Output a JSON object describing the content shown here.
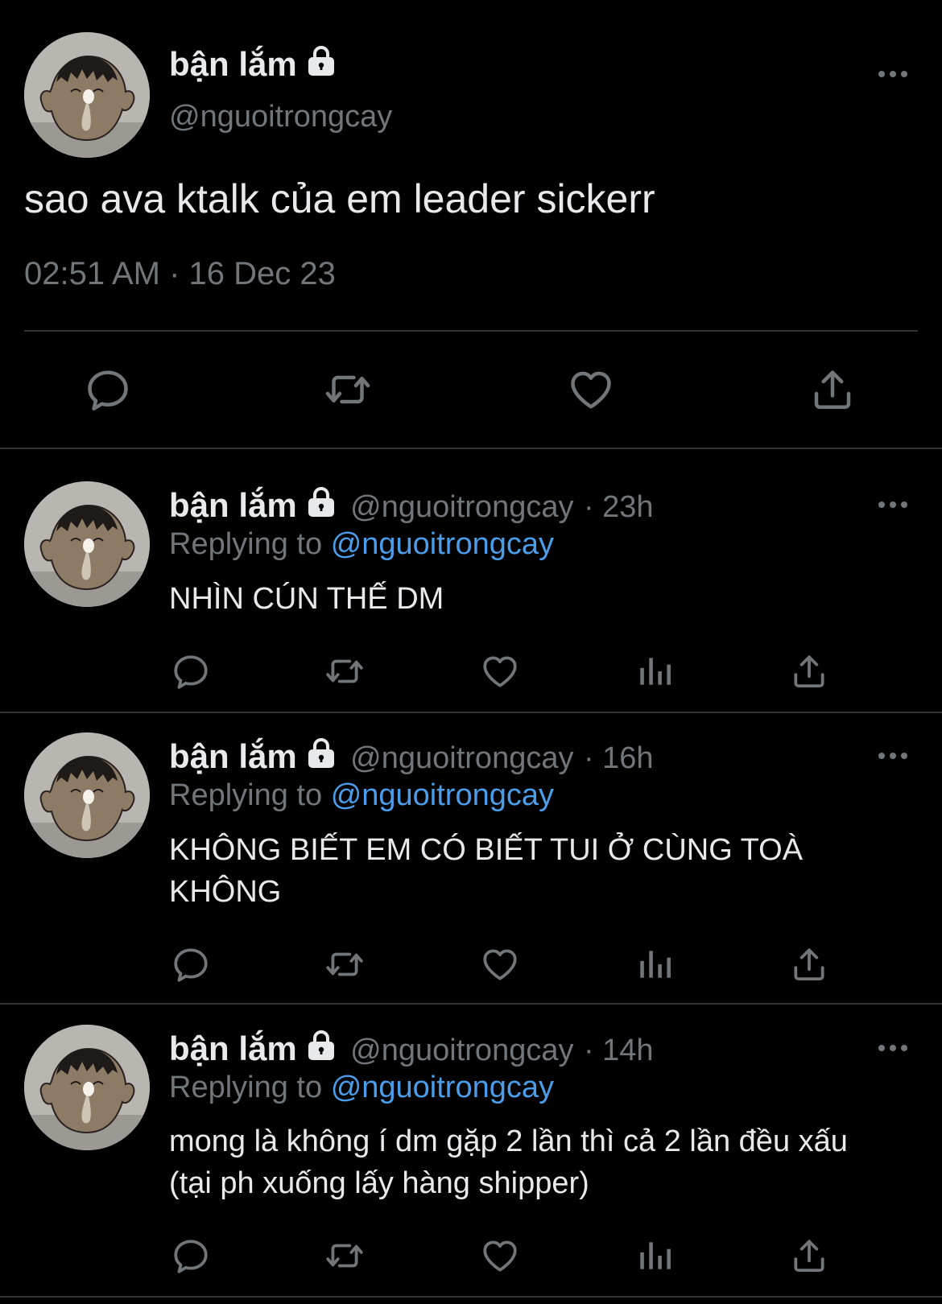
{
  "main_tweet": {
    "display_name": "bận lắm",
    "handle": "@nguoitrongcay",
    "text": "sao ava ktalk của em leader sickerr",
    "timestamp": "02:51 AM · 16 Dec 23"
  },
  "replies": [
    {
      "display_name": "bận lắm",
      "handle": "@nguoitrongcay",
      "time": "· 23h",
      "replying_label": "Replying to",
      "replying_handle": "@nguoitrongcay",
      "text": "NHÌN CÚN THẾ DM"
    },
    {
      "display_name": "bận lắm",
      "handle": "@nguoitrongcay",
      "time": "· 16h",
      "replying_label": "Replying to",
      "replying_handle": "@nguoitrongcay",
      "text": "KHÔNG BIẾT EM CÓ BIẾT TUI Ở CÙNG TOÀ KHÔNG"
    },
    {
      "display_name": "bận lắm",
      "handle": "@nguoitrongcay",
      "time": "· 14h",
      "replying_label": "Replying to",
      "replying_handle": "@nguoitrongcay",
      "text": "mong là không í dm gặp 2 lần thì cả 2 lần đều xấu (tại ph xuống lấy hàng shipper)"
    }
  ],
  "colors": {
    "background": "#000000",
    "text_primary": "#e7e9ea",
    "text_muted": "#71767b",
    "link": "#4b9ce9",
    "divider": "#2f3336"
  },
  "icons": [
    "avatar",
    "lock-icon",
    "more-icon",
    "reply-icon",
    "retweet-icon",
    "like-icon",
    "views-icon",
    "share-icon"
  ]
}
